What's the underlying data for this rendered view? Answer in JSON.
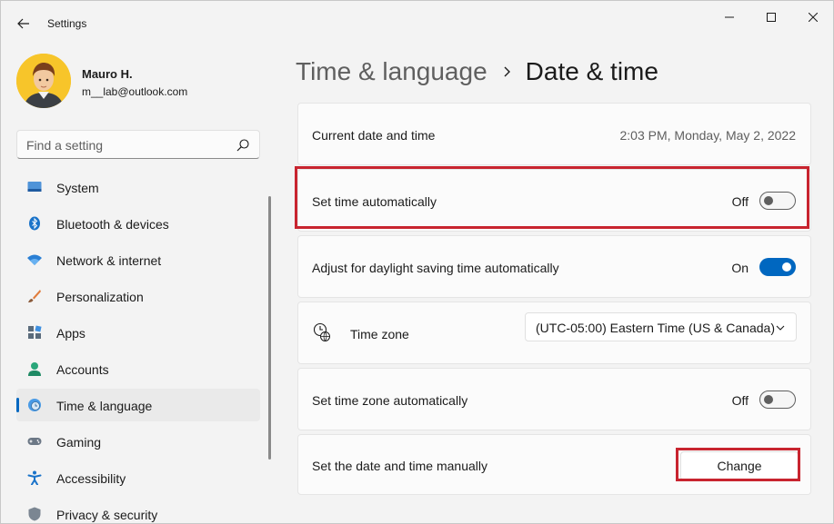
{
  "window": {
    "title": "Settings"
  },
  "profile": {
    "name": "Mauro H.",
    "email": "m__lab@outlook.com"
  },
  "search": {
    "placeholder": "Find a setting"
  },
  "nav": {
    "items": [
      {
        "label": "System",
        "icon": "system-icon"
      },
      {
        "label": "Bluetooth & devices",
        "icon": "bluetooth-icon"
      },
      {
        "label": "Network & internet",
        "icon": "wifi-icon"
      },
      {
        "label": "Personalization",
        "icon": "brush-icon"
      },
      {
        "label": "Apps",
        "icon": "apps-icon"
      },
      {
        "label": "Accounts",
        "icon": "accounts-icon"
      },
      {
        "label": "Time & language",
        "icon": "globe-clock-icon",
        "active": true
      },
      {
        "label": "Gaming",
        "icon": "gamepad-icon"
      },
      {
        "label": "Accessibility",
        "icon": "accessibility-icon"
      },
      {
        "label": "Privacy & security",
        "icon": "shield-icon"
      }
    ]
  },
  "breadcrumb": {
    "parent": "Time & language",
    "current": "Date & time"
  },
  "settings": {
    "current": {
      "label": "Current date and time",
      "value": "2:03 PM, Monday, May 2, 2022"
    },
    "set_time_auto": {
      "label": "Set time automatically",
      "state": "Off"
    },
    "daylight": {
      "label": "Adjust for daylight saving time automatically",
      "state": "On"
    },
    "timezone": {
      "label": "Time zone",
      "value": "(UTC-05:00) Eastern Time (US & Canada)"
    },
    "set_tz_auto": {
      "label": "Set time zone automatically",
      "state": "Off"
    },
    "manual": {
      "label": "Set the date and time manually",
      "button": "Change"
    }
  },
  "colors": {
    "accent": "#0067c0",
    "highlight": "#c8242f"
  }
}
